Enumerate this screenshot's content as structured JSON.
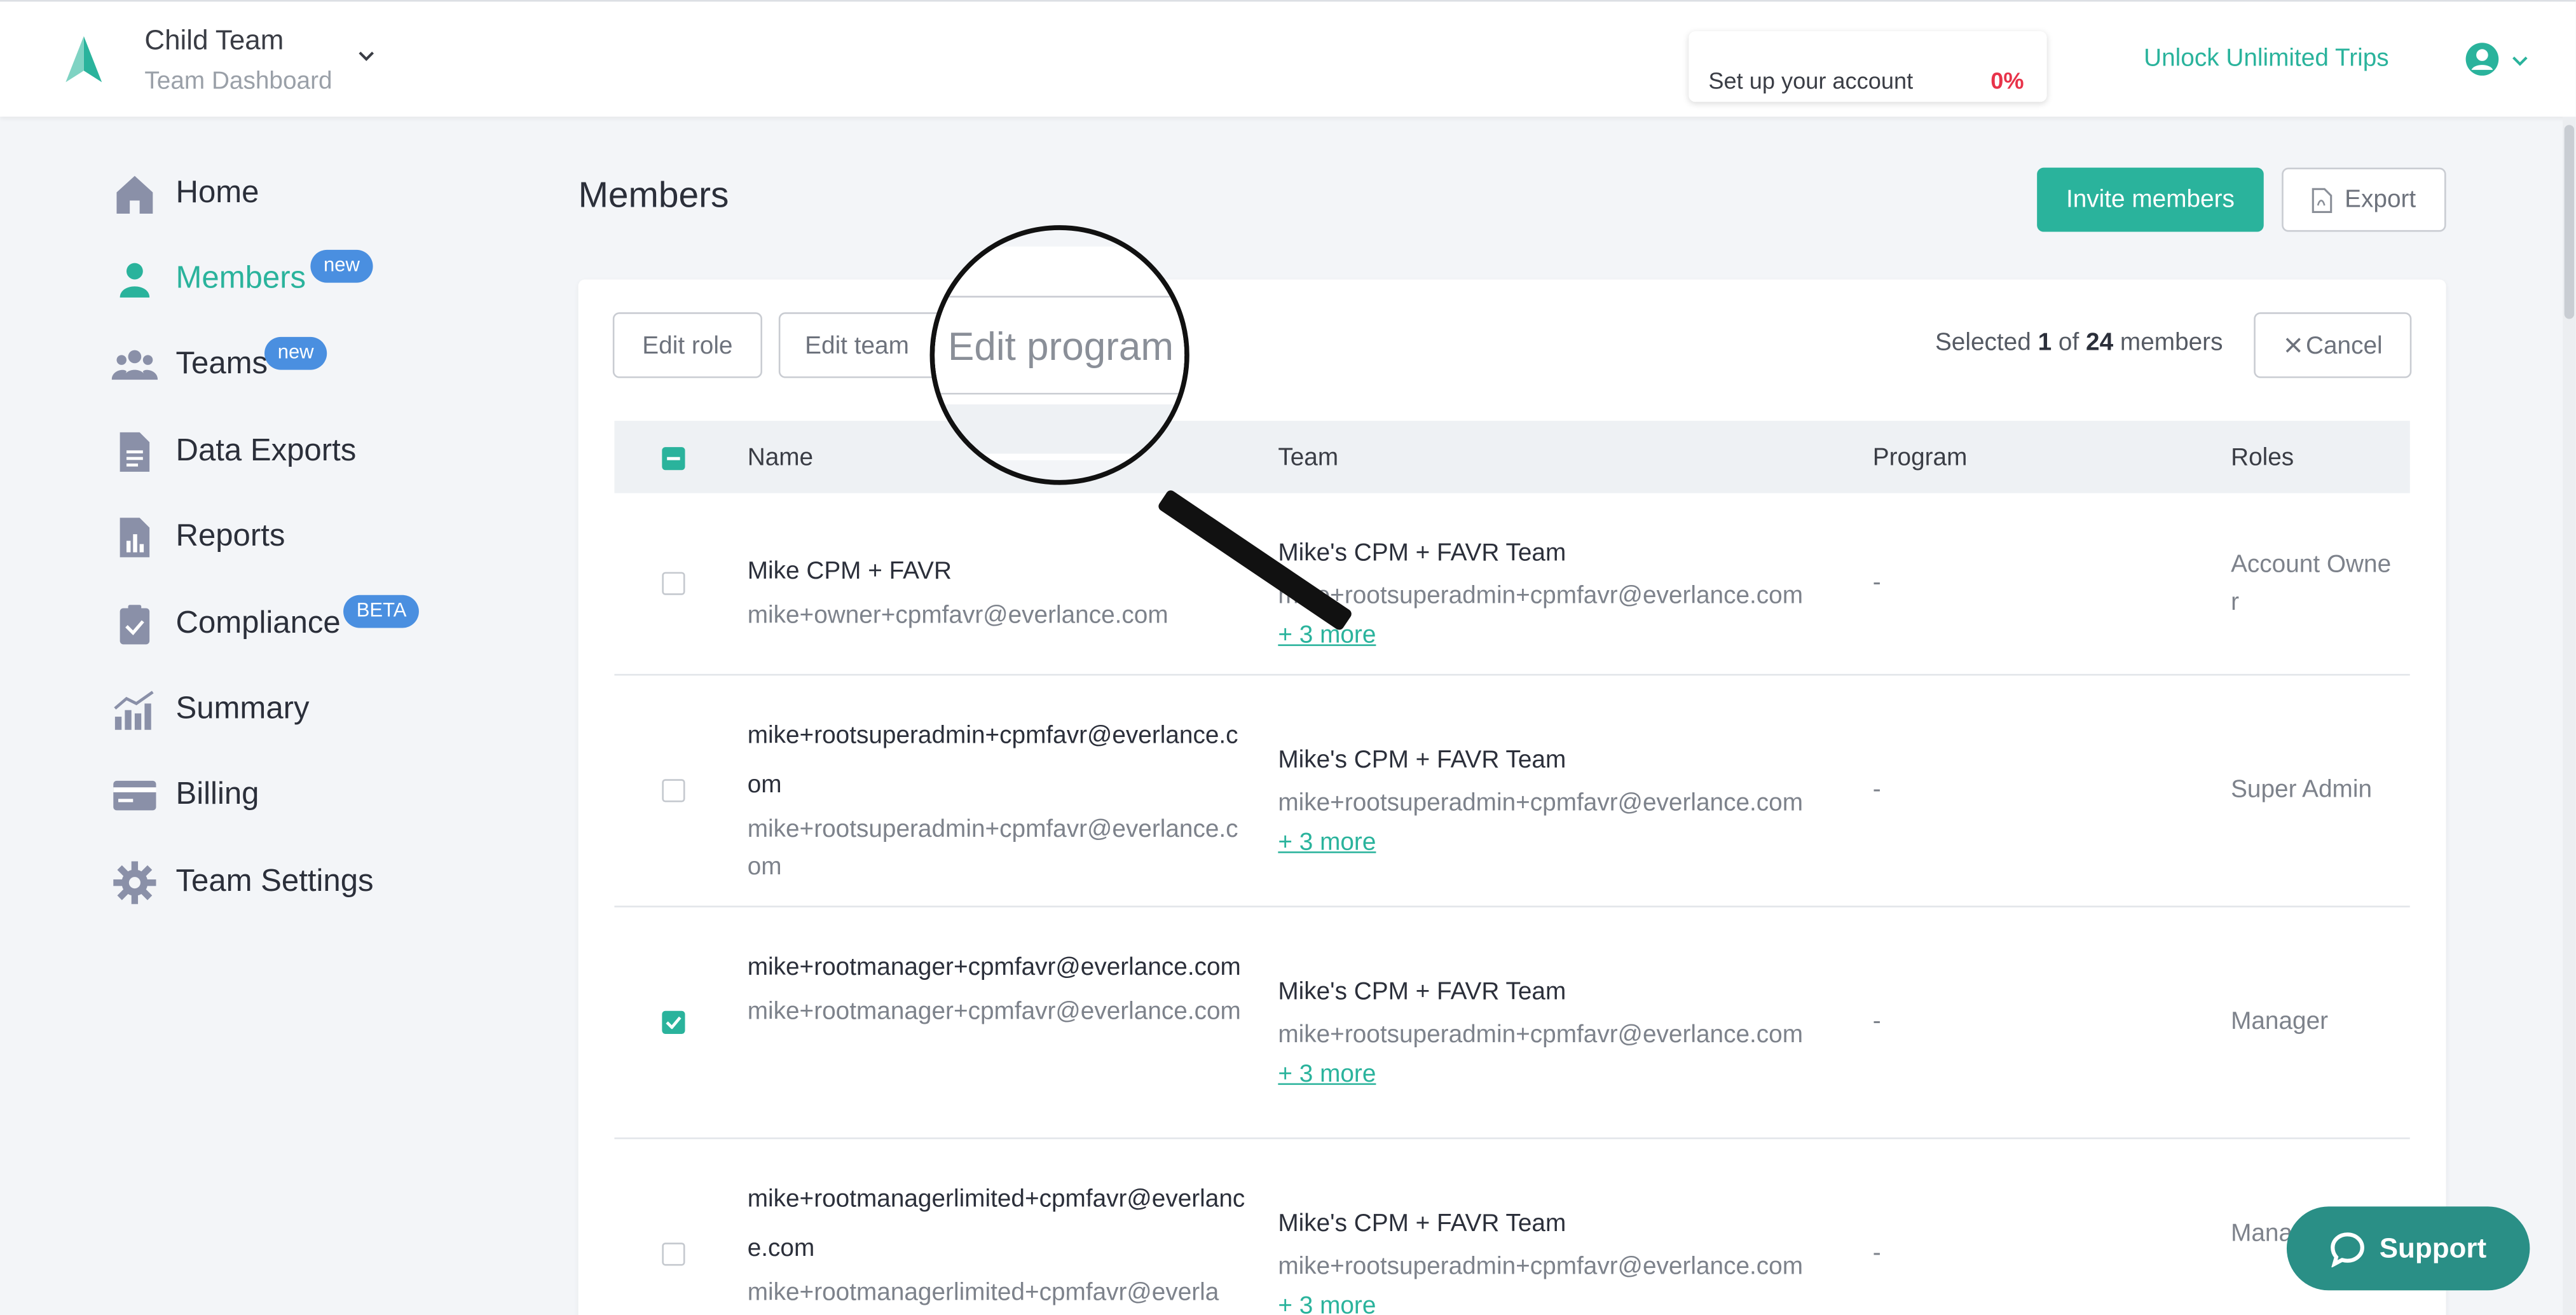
{
  "header": {
    "team_name": "Child Team",
    "team_subtitle": "Team Dashboard",
    "setup_label": "Set up your account",
    "setup_progress": "0%",
    "unlock_link": "Unlock Unlimited Trips"
  },
  "sidebar": {
    "items": [
      {
        "label": "Home",
        "icon": "home-icon"
      },
      {
        "label": "Members",
        "icon": "person-icon",
        "badge": "new",
        "active": true
      },
      {
        "label": "Teams",
        "icon": "people-icon",
        "badge": "new"
      },
      {
        "label": "Data Exports",
        "icon": "document-icon"
      },
      {
        "label": "Reports",
        "icon": "report-icon"
      },
      {
        "label": "Compliance",
        "icon": "clipboard-check-icon",
        "badge": "BETA"
      },
      {
        "label": "Summary",
        "icon": "chart-icon"
      },
      {
        "label": "Billing",
        "icon": "card-icon"
      },
      {
        "label": "Team Settings",
        "icon": "gear-icon"
      }
    ]
  },
  "main": {
    "title": "Members",
    "invite_button": "Invite members",
    "export_button": "Export",
    "actions": {
      "edit_role": "Edit role",
      "edit_team": "Edit team",
      "edit_program": "Edit program",
      "cancel": "Cancel"
    },
    "selection": {
      "prefix": "Selected",
      "selected": "1",
      "of": "of",
      "total": "24",
      "suffix": "members"
    },
    "columns": [
      "Name",
      "Team",
      "Program",
      "Roles"
    ],
    "rows": [
      {
        "name": "Mike CPM + FAVR",
        "email": "mike+owner+cpmfavr@everlance.com",
        "team": "Mike's CPM + FAVR Team",
        "team_email": "mike+rootsuperadmin+cpmfavr@everlance.com",
        "more": "+ 3 more",
        "program": "-",
        "role": "Account Owner",
        "checked": false
      },
      {
        "name": "mike+rootsuperadmin+cpmfavr@everlance.com",
        "email": "mike+rootsuperadmin+cpmfavr@everlance.com",
        "team": "Mike's CPM + FAVR Team",
        "team_email": "mike+rootsuperadmin+cpmfavr@everlance.com",
        "more": "+ 3 more",
        "program": "-",
        "role": "Super Admin",
        "checked": false
      },
      {
        "name": "mike+rootmanager+cpmfavr@everlance.com",
        "email": "mike+rootmanager+cpmfavr@everlance.com",
        "team": "Mike's CPM + FAVR Team",
        "team_email": "mike+rootsuperadmin+cpmfavr@everlance.com",
        "more": "+ 3 more",
        "program": "-",
        "role": "Manager",
        "checked": true
      },
      {
        "name": "mike+rootmanagerlimited+cpmfavr@everlance.com",
        "email": "mike+rootmanagerlimited+cpmfavr@everla",
        "team": "Mike's CPM + FAVR Team",
        "team_email": "mike+rootsuperadmin+cpmfavr@everlance.com",
        "more": "+ 3 more",
        "program": "-",
        "role": "Mana ed",
        "checked": false
      }
    ]
  },
  "support_button": "Support",
  "colors": {
    "accent": "#2ab39c",
    "badge": "#4a8fe0",
    "progress": "#e8334a",
    "support": "#2a8f86"
  }
}
